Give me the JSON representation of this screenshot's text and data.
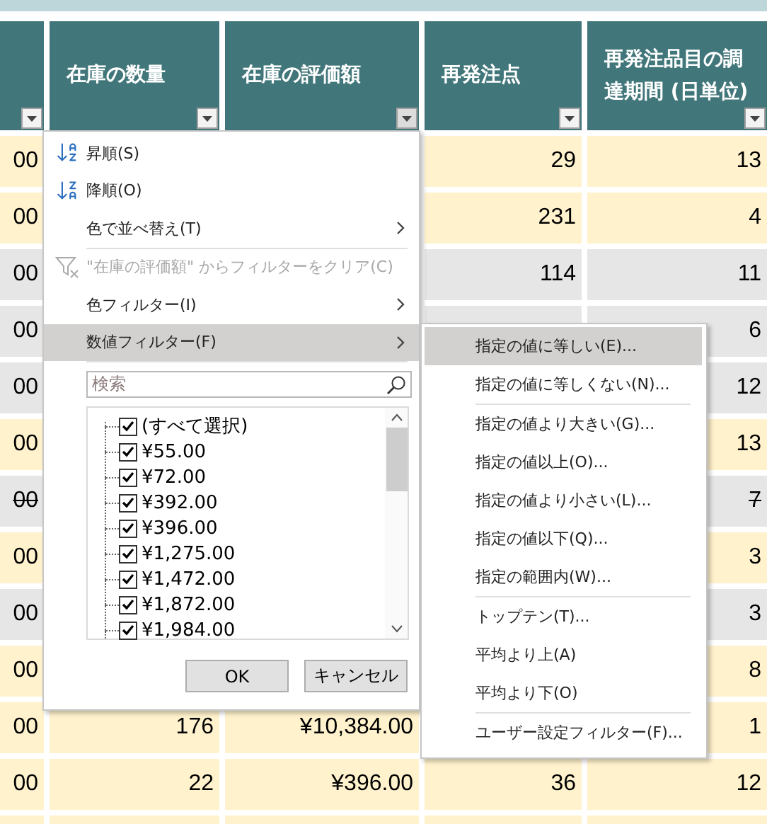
{
  "table": {
    "columns": [
      {},
      {
        "label": "在庫の数量"
      },
      {
        "label": "在庫の評価額",
        "filter_active": true
      },
      {
        "label": "再発注点"
      },
      {
        "label": "再発注品目の調達期間 (日単位)"
      }
    ],
    "rows": [
      {
        "color": "#fff2cc",
        "struck": false,
        "cells": [
          "00",
          null,
          null,
          "29",
          "13"
        ]
      },
      {
        "color": "#fff2cc",
        "struck": false,
        "cells": [
          "00",
          null,
          null,
          "231",
          "4"
        ]
      },
      {
        "color": "#e7e6e6",
        "struck": false,
        "cells": [
          "00",
          null,
          null,
          "114",
          "11"
        ]
      },
      {
        "color": "#e7e6e6",
        "struck": false,
        "cells": [
          "00",
          null,
          null,
          null,
          "6"
        ]
      },
      {
        "color": "#e7e6e6",
        "struck": false,
        "cells": [
          "00",
          null,
          null,
          null,
          "12"
        ]
      },
      {
        "color": "#fff2cc",
        "struck": false,
        "cells": [
          "00",
          null,
          null,
          null,
          "13"
        ]
      },
      {
        "color": "#e7e6e6",
        "struck": true,
        "cells": [
          "00",
          null,
          null,
          null,
          "7"
        ]
      },
      {
        "color": "#fff2cc",
        "struck": false,
        "cells": [
          "00",
          null,
          null,
          null,
          "3"
        ]
      },
      {
        "color": "#e7e6e6",
        "struck": false,
        "cells": [
          "00",
          null,
          null,
          null,
          "3"
        ]
      },
      {
        "color": "#fff2cc",
        "struck": false,
        "cells": [
          "00",
          null,
          null,
          null,
          "8"
        ]
      },
      {
        "color": "#fff2cc",
        "struck": false,
        "cells": [
          "00",
          "176",
          "¥10,384.00",
          null,
          "1"
        ]
      },
      {
        "color": "#fff2cc",
        "struck": false,
        "cells": [
          "00",
          "22",
          "¥396.00",
          "36",
          "12"
        ]
      },
      {
        "color": "#fff2cc",
        "cells": [
          null,
          null,
          null,
          null,
          null
        ]
      }
    ]
  },
  "filter_menu": {
    "sections": [
      [
        {
          "kind": "sort_asc",
          "label": "昇順(S)",
          "disabled": false,
          "selected": false,
          "submenu": false
        },
        {
          "kind": "sort_desc",
          "label": "降順(O)",
          "disabled": false,
          "selected": false,
          "submenu": false
        },
        {
          "kind": "plain",
          "label": "色で並べ替え(T)",
          "disabled": false,
          "selected": false,
          "submenu": true
        }
      ],
      [
        {
          "kind": "clear",
          "label": "\"在庫の評価額\" からフィルターをクリア(C)",
          "disabled": true,
          "selected": false,
          "submenu": false
        },
        {
          "kind": "plain",
          "label": "色フィルター(I)",
          "disabled": false,
          "selected": false,
          "submenu": true
        },
        {
          "kind": "plain",
          "label": "数値フィルター(F)",
          "disabled": false,
          "selected": true,
          "submenu": true
        }
      ]
    ],
    "search": {
      "placeholder": "検索"
    },
    "values": [
      {
        "label": "(すべて選択)",
        "checked": true
      },
      {
        "label": "¥55.00",
        "checked": true
      },
      {
        "label": "¥72.00",
        "checked": true
      },
      {
        "label": "¥392.00",
        "checked": true
      },
      {
        "label": "¥396.00",
        "checked": true
      },
      {
        "label": "¥1,275.00",
        "checked": true
      },
      {
        "label": "¥1,472.00",
        "checked": true
      },
      {
        "label": "¥1,872.00",
        "checked": true
      },
      {
        "label": "¥1,984.00",
        "checked": true
      }
    ],
    "buttons": [
      "OK",
      "キャンセル"
    ]
  },
  "number_filter_submenu": {
    "sections": [
      [
        {
          "label": "指定の値に等しい(E)...",
          "selected": true
        },
        {
          "label": "指定の値に等しくない(N)...",
          "selected": false
        }
      ],
      [
        {
          "label": "指定の値より大きい(G)...",
          "selected": false
        },
        {
          "label": "指定の値以上(O)...",
          "selected": false
        },
        {
          "label": "指定の値より小さい(L)...",
          "selected": false
        },
        {
          "label": "指定の値以下(Q)...",
          "selected": false
        },
        {
          "label": "指定の範囲内(W)...",
          "selected": false
        }
      ],
      [
        {
          "label": "トップテン(T)...",
          "selected": false
        },
        {
          "label": "平均より上(A)",
          "selected": false
        },
        {
          "label": "平均より下(O)",
          "selected": false
        }
      ],
      [
        {
          "label": "ユーザー設定フィルター(F)...",
          "selected": false
        }
      ]
    ]
  }
}
